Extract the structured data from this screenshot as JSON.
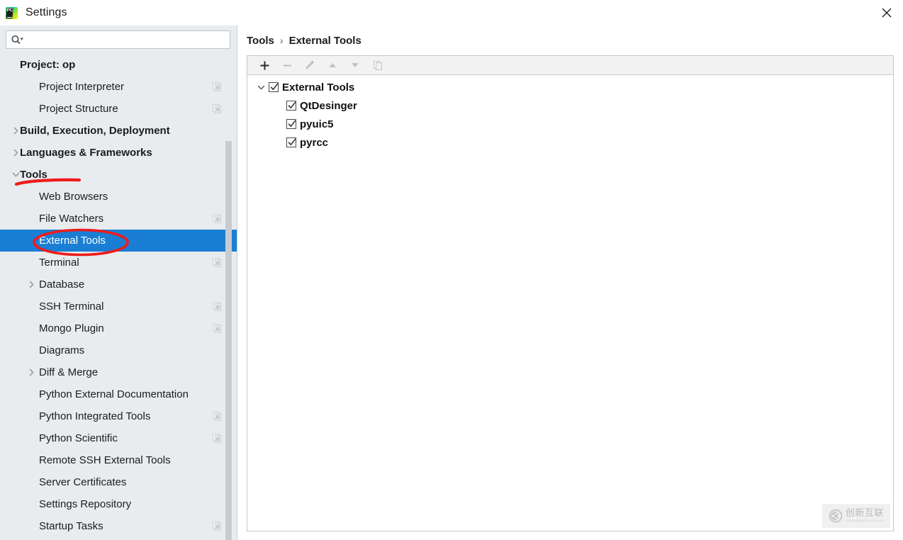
{
  "window": {
    "title": "Settings",
    "app_icon": "pycharm-icon",
    "close_icon": "close-icon"
  },
  "search": {
    "value": "",
    "placeholder": "",
    "icon": "search-icon",
    "dropdown_icon": "chevron-down-icon"
  },
  "sidebar": {
    "items": [
      {
        "label": "Project: op",
        "indent": 0,
        "bold": true,
        "twisty": "none",
        "selected": false,
        "mod_icon": false
      },
      {
        "label": "Project Interpreter",
        "indent": 1,
        "bold": false,
        "twisty": "none",
        "selected": false,
        "mod_icon": true
      },
      {
        "label": "Project Structure",
        "indent": 1,
        "bold": false,
        "twisty": "none",
        "selected": false,
        "mod_icon": true
      },
      {
        "label": "Build, Execution, Deployment",
        "indent": 0,
        "bold": true,
        "twisty": "collapsed",
        "selected": false,
        "mod_icon": false
      },
      {
        "label": "Languages & Frameworks",
        "indent": 0,
        "bold": true,
        "twisty": "collapsed",
        "selected": false,
        "mod_icon": false
      },
      {
        "label": "Tools",
        "indent": 0,
        "bold": true,
        "twisty": "expanded",
        "selected": false,
        "mod_icon": false
      },
      {
        "label": "Web Browsers",
        "indent": 1,
        "bold": false,
        "twisty": "none",
        "selected": false,
        "mod_icon": false
      },
      {
        "label": "File Watchers",
        "indent": 1,
        "bold": false,
        "twisty": "none",
        "selected": false,
        "mod_icon": true
      },
      {
        "label": "External Tools",
        "indent": 1,
        "bold": false,
        "twisty": "none",
        "selected": true,
        "mod_icon": false
      },
      {
        "label": "Terminal",
        "indent": 1,
        "bold": false,
        "twisty": "none",
        "selected": false,
        "mod_icon": true
      },
      {
        "label": "Database",
        "indent": 1,
        "bold": false,
        "twisty": "collapsed",
        "selected": false,
        "mod_icon": false
      },
      {
        "label": "SSH Terminal",
        "indent": 1,
        "bold": false,
        "twisty": "none",
        "selected": false,
        "mod_icon": true
      },
      {
        "label": "Mongo Plugin",
        "indent": 1,
        "bold": false,
        "twisty": "none",
        "selected": false,
        "mod_icon": true
      },
      {
        "label": "Diagrams",
        "indent": 1,
        "bold": false,
        "twisty": "none",
        "selected": false,
        "mod_icon": false
      },
      {
        "label": "Diff & Merge",
        "indent": 1,
        "bold": false,
        "twisty": "collapsed",
        "selected": false,
        "mod_icon": false
      },
      {
        "label": "Python External Documentation",
        "indent": 1,
        "bold": false,
        "twisty": "none",
        "selected": false,
        "mod_icon": false
      },
      {
        "label": "Python Integrated Tools",
        "indent": 1,
        "bold": false,
        "twisty": "none",
        "selected": false,
        "mod_icon": true
      },
      {
        "label": "Python Scientific",
        "indent": 1,
        "bold": false,
        "twisty": "none",
        "selected": false,
        "mod_icon": true
      },
      {
        "label": "Remote SSH External Tools",
        "indent": 1,
        "bold": false,
        "twisty": "none",
        "selected": false,
        "mod_icon": false
      },
      {
        "label": "Server Certificates",
        "indent": 1,
        "bold": false,
        "twisty": "none",
        "selected": false,
        "mod_icon": false
      },
      {
        "label": "Settings Repository",
        "indent": 1,
        "bold": false,
        "twisty": "none",
        "selected": false,
        "mod_icon": false
      },
      {
        "label": "Startup Tasks",
        "indent": 1,
        "bold": false,
        "twisty": "none",
        "selected": false,
        "mod_icon": true
      }
    ],
    "selected_label": "External Tools",
    "selection_color": "#1a7fd4"
  },
  "breadcrumb": {
    "parent": "Tools",
    "separator": "›",
    "current": "External Tools"
  },
  "toolbar": {
    "buttons": [
      {
        "name": "add-button",
        "icon": "plus-icon",
        "enabled": true
      },
      {
        "name": "remove-button",
        "icon": "minus-icon",
        "enabled": false
      },
      {
        "name": "edit-button",
        "icon": "pencil-icon",
        "enabled": false
      },
      {
        "name": "move-up-button",
        "icon": "arrow-up-icon",
        "enabled": false
      },
      {
        "name": "move-down-button",
        "icon": "arrow-down-icon",
        "enabled": false
      },
      {
        "name": "copy-button",
        "icon": "copy-icon",
        "enabled": false
      }
    ]
  },
  "tools_tree": {
    "root": {
      "label": "External Tools",
      "checked": true,
      "expanded": true
    },
    "children": [
      {
        "label": "QtDesinger",
        "checked": true
      },
      {
        "label": "pyuic5",
        "checked": true
      },
      {
        "label": "pyrcc",
        "checked": true
      }
    ]
  },
  "annotations": {
    "color": "#ee1c1c",
    "underline_target": "Tools",
    "ellipse_target": "External Tools"
  },
  "watermark": {
    "cn_text": "创新互联",
    "en_text": "CHUANGXIN HULIAN",
    "logo": "cx-circle-logo"
  }
}
